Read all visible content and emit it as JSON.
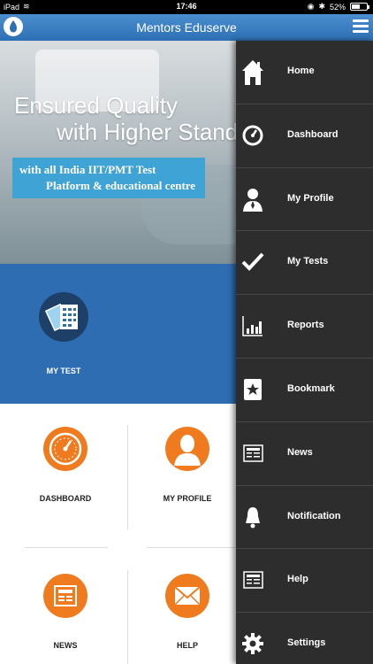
{
  "status_bar": {
    "device": "iPad",
    "time": "17:46",
    "battery": "52%",
    "battery_level": 0.52
  },
  "header": {
    "title": "Mentors Eduserve"
  },
  "banner": {
    "line1": "Ensured Quality",
    "line2": "with Higher Standards",
    "tag_line1": "with all India IIT/PMT Test",
    "tag_line2": "Platform & educational centre"
  },
  "tiles": {
    "my_test": "MY TEST",
    "dashboard": "DASHBOARD",
    "my_profile": "MY PROFILE",
    "news": "NEWS",
    "help": "HELP"
  },
  "menu": {
    "items": [
      {
        "label": "Home",
        "icon": "home-icon"
      },
      {
        "label": "Dashboard",
        "icon": "dashboard-icon"
      },
      {
        "label": "My Profile",
        "icon": "profile-icon"
      },
      {
        "label": "My Tests",
        "icon": "checkmark-icon"
      },
      {
        "label": "Reports",
        "icon": "bar-chart-icon"
      },
      {
        "label": "Bookmark",
        "icon": "bookmark-icon"
      },
      {
        "label": "News",
        "icon": "newspaper-icon"
      },
      {
        "label": "Notification",
        "icon": "bell-icon"
      },
      {
        "label": "Help",
        "icon": "help-icon"
      },
      {
        "label": "Settings",
        "icon": "gear-icon"
      }
    ]
  },
  "colors": {
    "header": "#2d6fb3",
    "band": "#2f6db2",
    "accent": "#f07b1f",
    "drawer": "#2d2d2d"
  }
}
